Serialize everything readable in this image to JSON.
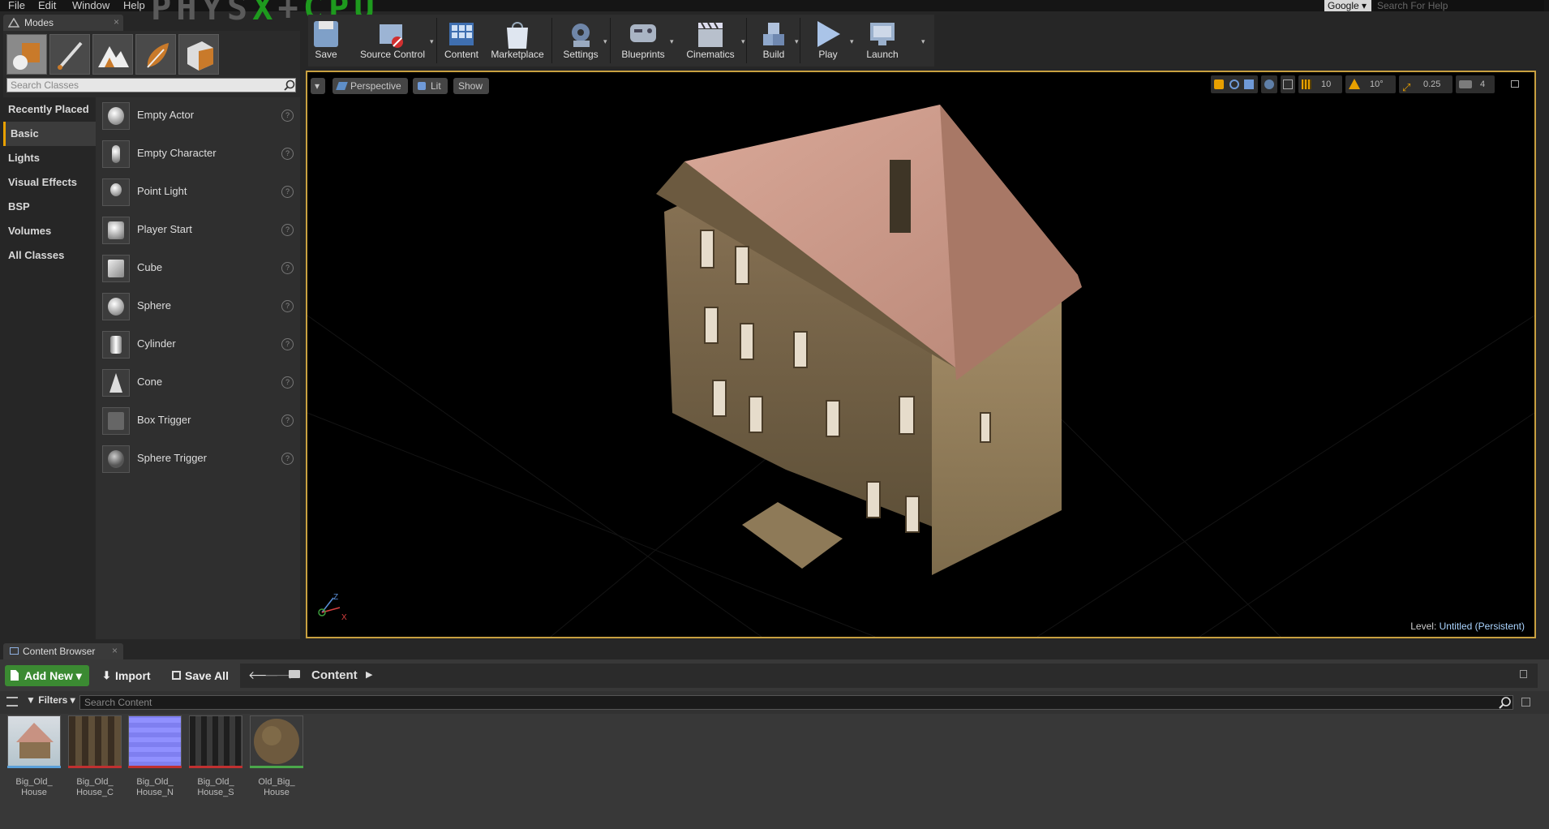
{
  "menubar": {
    "items": [
      "File",
      "Edit",
      "Window",
      "Help"
    ],
    "overlay_left": "PHYS",
    "overlay_x": "X",
    "overlay_plus": "+",
    "overlay_cpu": "CPU",
    "search_provider": "Google",
    "search_placeholder": "Search For Help"
  },
  "modes": {
    "tab_title": "Modes",
    "search_placeholder": "Search Classes",
    "categories": [
      "Recently Placed",
      "Basic",
      "Lights",
      "Visual Effects",
      "BSP",
      "Volumes",
      "All Classes"
    ],
    "selected_category": "Basic",
    "classes": [
      "Empty Actor",
      "Empty Character",
      "Point Light",
      "Player Start",
      "Cube",
      "Sphere",
      "Cylinder",
      "Cone",
      "Box Trigger",
      "Sphere Trigger"
    ],
    "help_glyph": "?"
  },
  "toolbar": {
    "buttons": [
      "Save",
      "Source Control",
      "Content",
      "Marketplace",
      "Settings",
      "Blueprints",
      "Cinematics",
      "Build",
      "Play",
      "Launch"
    ],
    "caret": "▾"
  },
  "viewport": {
    "perspective": "Perspective",
    "lit": "Lit",
    "show": "Show",
    "grid_snap": "10",
    "rotation_snap": "10°",
    "scale_snap": "0.25",
    "camera_speed": "4",
    "level_label": "Level:",
    "level_name": "Untitled (Persistent)",
    "axis_z": "Z",
    "axis_x": "X"
  },
  "content_browser": {
    "tab_title": "Content Browser",
    "add_new": "Add New",
    "import": "Import",
    "save_all": "Save All",
    "path": "Content",
    "filters": "Filters",
    "search_placeholder": "Search Content",
    "assets": [
      {
        "name": "Big_Old_ House",
        "bar_color": "#5aa0d8"
      },
      {
        "name": "Big_Old_ House_C",
        "bar_color": "#c03030"
      },
      {
        "name": "Big_Old_ House_N",
        "bar_color": "#c03030"
      },
      {
        "name": "Big_Old_ House_S",
        "bar_color": "#c03030"
      },
      {
        "name": "Old_Big_ House",
        "bar_color": "#4aa84a"
      }
    ]
  },
  "colors": {
    "accent": "#e8a000",
    "add_new_green": "#3b8a32",
    "viewport_border": "#c8a040"
  }
}
